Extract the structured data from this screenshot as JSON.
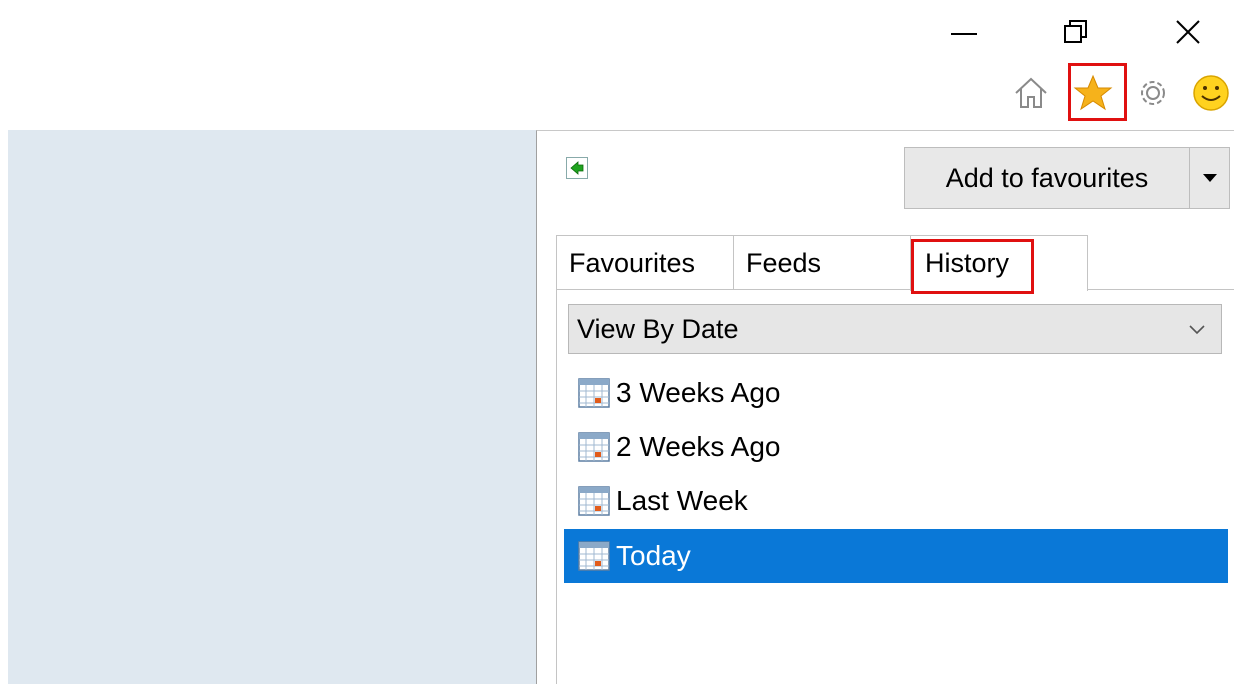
{
  "window_controls": {
    "minimize_icon": "minimize-icon",
    "restore_icon": "restore-icon",
    "close_icon": "close-icon"
  },
  "toolbar": {
    "icons": [
      "home-icon",
      "star-icon",
      "gear-icon",
      "smiley-icon"
    ],
    "highlight_color": "#e01010"
  },
  "panel": {
    "pin_icon": "pin-panel-icon",
    "add_button_label": "Add to favourites",
    "tabs": [
      "Favourites",
      "Feeds",
      "History"
    ],
    "active_tab": "History",
    "view_select_value": "View By Date",
    "history_items": [
      "3 Weeks Ago",
      "2 Weeks Ago",
      "Last Week",
      "Today"
    ],
    "selected_item": "Today",
    "selection_color": "#0a78d7"
  }
}
